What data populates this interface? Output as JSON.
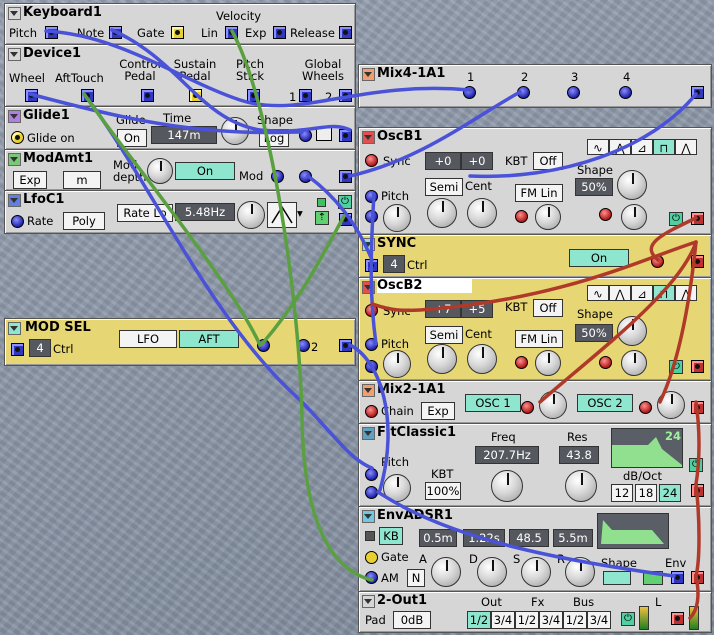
{
  "modules": {
    "keyboard": {
      "title": "Keyboard1",
      "pitch": "Pitch",
      "note": "Note",
      "gate": "Gate",
      "velocity": "Velocity",
      "lin": "Lin",
      "exp": "Exp",
      "release": "Release"
    },
    "device": {
      "title": "Device1",
      "wheel": "Wheel",
      "aftertouch": "AftTouch",
      "control_pedal": "Control\nPedal",
      "sustain_pedal": "Sustain\nPedal",
      "pitch_stick": "Pitch\nStick",
      "global_wheels": "Global\nWheels",
      "gw1": "1",
      "gw2": "2"
    },
    "glide": {
      "title": "Glide1",
      "glide_on": "Glide on",
      "glide": "Glide",
      "glide_value": "On",
      "time": "Time",
      "time_value": "147m",
      "shape": "Shape",
      "shape_value": "Log"
    },
    "modamt": {
      "title": "ModAmt1",
      "exp": "Exp",
      "m": "m",
      "mod_depth": "Mod\ndepth",
      "on": "On",
      "mod": "Mod"
    },
    "lfo": {
      "title": "LfoC1",
      "rate": "Rate",
      "poly": "Poly",
      "rate_lo": "Rate Lo",
      "rate_value": "5.48Hz"
    },
    "modsel": {
      "title": "MOD SEL",
      "channels": "4",
      "ctrl": "Ctrl",
      "lfo": "LFO",
      "aft": "AFT",
      "out": "2"
    },
    "mix4": {
      "title": "Mix4-1A1",
      "inputs": [
        "1",
        "2",
        "3",
        "4"
      ]
    },
    "oscb1": {
      "title": "OscB1",
      "sync": "Sync",
      "semi_value": "+0",
      "cent_value": "+0",
      "kbt": "KBT",
      "kbt_value": "Off",
      "pitch": "Pitch",
      "semi": "Semi",
      "cent": "Cent",
      "fm_lin": "FM Lin",
      "shape": "Shape",
      "shape_value": "50%"
    },
    "sync": {
      "title": "SYNC",
      "channels": "4",
      "ctrl": "Ctrl",
      "on": "On"
    },
    "oscb2": {
      "title": "OscB2",
      "sync": "Sync",
      "semi_value": "+7",
      "cent_value": "+5",
      "kbt": "KBT",
      "kbt_value": "Off",
      "pitch": "Pitch",
      "semi": "Semi",
      "cent": "Cent",
      "fm_lin": "FM Lin",
      "shape": "Shape",
      "shape_value": "50%"
    },
    "mix2": {
      "title": "Mix2-1A1",
      "chain": "Chain",
      "exp": "Exp",
      "osc1": "OSC 1",
      "osc2": "OSC 2"
    },
    "filter": {
      "title": "FltClassic1",
      "freq": "Freq",
      "freq_value": "207.7Hz",
      "res": "Res",
      "res_value": "43.8",
      "pitch": "Pitch",
      "kbt": "KBT",
      "kbt_value": "100%",
      "db_oct": "dB/Oct",
      "slopes": [
        "12",
        "18",
        "24"
      ],
      "graph_label": "24"
    },
    "env": {
      "title": "EnvADSR1",
      "kb": "KB",
      "gate": "Gate",
      "am": "AM",
      "n": "N",
      "a": "A",
      "d": "D",
      "s": "S",
      "r": "R",
      "a_value": "0.5m",
      "d_value": "1.22s",
      "s_value": "48.5",
      "r_value": "5.5m",
      "shape": "Shape",
      "env": "Env"
    },
    "out": {
      "title": "2-Out1",
      "pad": "Pad",
      "pad_value": "0dB",
      "out": "Out",
      "fx": "Fx",
      "bus": "Bus",
      "sel": "1/2",
      "sel2": "3/4",
      "l": "L"
    }
  },
  "colors": {
    "panel": "#d6d6d6",
    "yellow_panel": "#e7d674",
    "cyan_display": "#8ee6cf",
    "blue_cable": "#4a52d8",
    "red_cable": "#b03a2a",
    "green_cable": "#5aa040"
  }
}
